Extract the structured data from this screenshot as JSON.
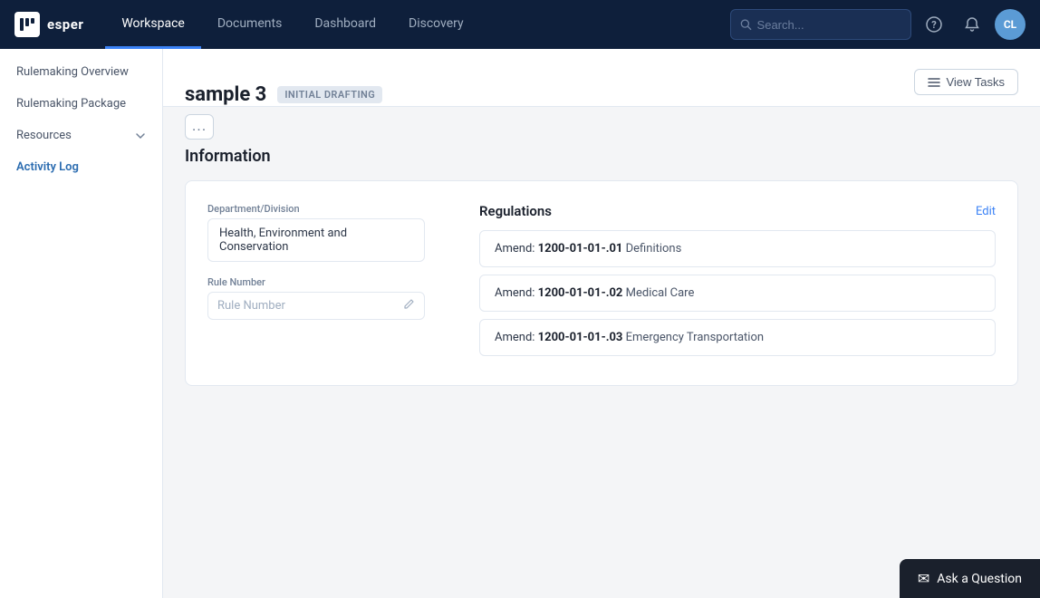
{
  "topnav": {
    "logo_text": "esper",
    "links": [
      {
        "label": "Workspace",
        "active": true
      },
      {
        "label": "Documents",
        "active": false
      },
      {
        "label": "Dashboard",
        "active": false
      },
      {
        "label": "Discovery",
        "active": false
      }
    ],
    "search_placeholder": "Search...",
    "avatar_initials": "CL"
  },
  "sidebar": {
    "items": [
      {
        "label": "Rulemaking Overview",
        "active": false
      },
      {
        "label": "Rulemaking Package",
        "active": false
      },
      {
        "label": "Resources",
        "active": false,
        "has_arrow": true
      },
      {
        "label": "Activity Log",
        "active": true
      }
    ]
  },
  "page": {
    "title": "sample 3",
    "status": "INITIAL DRAFTING",
    "view_tasks_label": "View Tasks",
    "more_label": "...",
    "section_title": "Information"
  },
  "fields": {
    "department_label": "Department/Division",
    "department_value": "Health, Environment and Conservation",
    "rule_number_label": "Rule Number",
    "rule_number_placeholder": "Rule Number"
  },
  "regulations": {
    "title": "Regulations",
    "edit_label": "Edit",
    "items": [
      {
        "code": "1200-01-01-.01",
        "prefix": "Amend: ",
        "description": " Definitions"
      },
      {
        "code": "1200-01-01-.02",
        "prefix": "Amend: ",
        "description": " Medical Care"
      },
      {
        "code": "1200-01-01-.03",
        "prefix": "Amend: ",
        "description": " Emergency Transportation"
      }
    ]
  },
  "ask_button": {
    "label": "Ask a Question",
    "icon": "✉"
  }
}
